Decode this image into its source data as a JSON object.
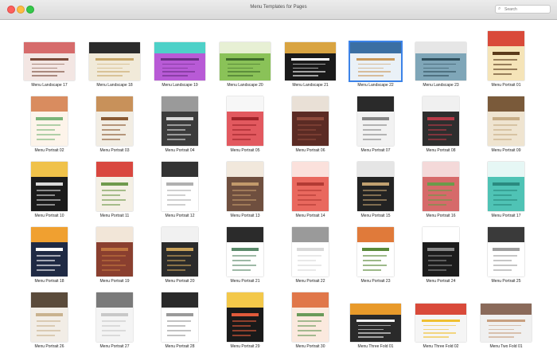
{
  "window": {
    "title": "Menu Templates for Pages"
  },
  "search": {
    "placeholder": "Search",
    "value": ""
  },
  "templates": [
    {
      "label": "Menu Landscape 17",
      "orientation": "land",
      "colors": [
        "#f3e6e3",
        "#d66b6b",
        "#7a4b3a"
      ]
    },
    {
      "label": "Menu Landscape 18",
      "orientation": "land",
      "colors": [
        "#f1ead9",
        "#2b2b2b",
        "#c9a86a"
      ]
    },
    {
      "label": "Menu Landscape 19",
      "orientation": "land",
      "colors": [
        "#b85ad6",
        "#4ed1c8",
        "#6b2d85"
      ]
    },
    {
      "label": "Menu Landscape 20",
      "orientation": "land",
      "colors": [
        "#8ac258",
        "#e7f0d4",
        "#3e6b2a"
      ]
    },
    {
      "label": "Menu Landscape 21",
      "orientation": "land",
      "colors": [
        "#1a1a1a",
        "#d9a441",
        "#ffffff"
      ]
    },
    {
      "label": "Menu Landscape 22",
      "orientation": "land",
      "colors": [
        "#eaf1f7",
        "#3b6fa3",
        "#c99a5c"
      ],
      "selected": true
    },
    {
      "label": "Menu Landscape 23",
      "orientation": "land",
      "colors": [
        "#7fa6b8",
        "#e6e6e6",
        "#2f4f5c"
      ]
    },
    {
      "label": "Menu Portrait 01",
      "orientation": "port",
      "colors": [
        "#f5e4b8",
        "#d94a3a",
        "#5a3a1a"
      ]
    },
    {
      "label": "Menu Portrait 02",
      "orientation": "port",
      "colors": [
        "#fdf4ea",
        "#d98c5f",
        "#7bb57a"
      ]
    },
    {
      "label": "Menu Portrait 03",
      "orientation": "port",
      "colors": [
        "#f2ede3",
        "#c8915a",
        "#8a5a33"
      ]
    },
    {
      "label": "Menu Portrait 04",
      "orientation": "port",
      "colors": [
        "#3c3c3c",
        "#9a9a9a",
        "#d8d8d8"
      ]
    },
    {
      "label": "Menu Portrait 05",
      "orientation": "port",
      "colors": [
        "#e2595f",
        "#f7f7f7",
        "#a0242a"
      ]
    },
    {
      "label": "Menu Portrait 06",
      "orientation": "port",
      "colors": [
        "#5b2b24",
        "#e9e0d6",
        "#8e4a3c"
      ]
    },
    {
      "label": "Menu Portrait 07",
      "orientation": "port",
      "colors": [
        "#f2f2f2",
        "#2a2a2a",
        "#888888"
      ]
    },
    {
      "label": "Menu Portrait 08",
      "orientation": "port",
      "colors": [
        "#2e2e2e",
        "#f0f0f0",
        "#b73a48"
      ]
    },
    {
      "label": "Menu Portrait 09",
      "orientation": "port",
      "colors": [
        "#efe4d0",
        "#7a5a3a",
        "#c7ad86"
      ]
    },
    {
      "label": "Menu Portrait 10",
      "orientation": "port",
      "colors": [
        "#1b1b1b",
        "#f0c24a",
        "#d9d9d9"
      ]
    },
    {
      "label": "Menu Portrait 11",
      "orientation": "port",
      "colors": [
        "#f4efe4",
        "#d9473f",
        "#6f9a4d"
      ]
    },
    {
      "label": "Menu Portrait 12",
      "orientation": "port",
      "colors": [
        "#ffffff",
        "#333333",
        "#b0b0b0"
      ]
    },
    {
      "label": "Menu Portrait 13",
      "orientation": "port",
      "colors": [
        "#6f4f3f",
        "#f1e8dc",
        "#c29a6b"
      ]
    },
    {
      "label": "Menu Portrait 14",
      "orientation": "port",
      "colors": [
        "#e9685e",
        "#fbe1dc",
        "#b23a33"
      ]
    },
    {
      "label": "Menu Portrait 15",
      "orientation": "port",
      "colors": [
        "#232323",
        "#e5e5e5",
        "#c0a070"
      ]
    },
    {
      "label": "Menu Portrait 16",
      "orientation": "port",
      "colors": [
        "#d66a6a",
        "#f4d9d9",
        "#6b9a4a"
      ]
    },
    {
      "label": "Menu Portrait 17",
      "orientation": "port",
      "colors": [
        "#4fc3b5",
        "#e6f7f5",
        "#2a8a7f"
      ]
    },
    {
      "label": "Menu Portrait 18",
      "orientation": "port",
      "colors": [
        "#1f2a44",
        "#f0a030",
        "#ffffff"
      ]
    },
    {
      "label": "Menu Portrait 19",
      "orientation": "port",
      "colors": [
        "#8a3f2f",
        "#f2e6d8",
        "#c0753f"
      ]
    },
    {
      "label": "Menu Portrait 20",
      "orientation": "port",
      "colors": [
        "#2b2b2b",
        "#f1f1f1",
        "#c9a25a"
      ]
    },
    {
      "label": "Menu Portrait 21",
      "orientation": "port",
      "colors": [
        "#ffffff",
        "#2b2b2b",
        "#5b8a6b"
      ]
    },
    {
      "label": "Menu Portrait 22",
      "orientation": "port",
      "colors": [
        "#ffffff",
        "#9a9a9a",
        "#d9d9d9"
      ]
    },
    {
      "label": "Menu Portrait 23",
      "orientation": "port",
      "colors": [
        "#ffffff",
        "#e07a3a",
        "#5a8a3a"
      ]
    },
    {
      "label": "Menu Portrait 24",
      "orientation": "port",
      "colors": [
        "#1c1c1c",
        "#ffffff",
        "#888888"
      ]
    },
    {
      "label": "Menu Portrait 25",
      "orientation": "port",
      "colors": [
        "#ffffff",
        "#3a3a3a",
        "#a0a0a0"
      ]
    },
    {
      "label": "Menu Portrait 26",
      "orientation": "port",
      "colors": [
        "#f2ede6",
        "#5b4b3b",
        "#c9b28f"
      ]
    },
    {
      "label": "Menu Portrait 27",
      "orientation": "port",
      "colors": [
        "#f4f4f4",
        "#7a7a7a",
        "#c8c8c8"
      ]
    },
    {
      "label": "Menu Portrait 28",
      "orientation": "port",
      "colors": [
        "#ffffff",
        "#2a2a2a",
        "#9a9a9a"
      ]
    },
    {
      "label": "Menu Portrait 29",
      "orientation": "port",
      "colors": [
        "#1a1a1a",
        "#f3c84a",
        "#e05a3a"
      ]
    },
    {
      "label": "Menu Portrait 30",
      "orientation": "port",
      "colors": [
        "#fbe9de",
        "#e0774a",
        "#6a9a5a"
      ]
    },
    {
      "label": "Menu Three Fold 01",
      "orientation": "land",
      "colors": [
        "#2a2a2a",
        "#e89a2a",
        "#f5f5f5"
      ]
    },
    {
      "label": "Menu Three Fold 02",
      "orientation": "land",
      "colors": [
        "#f5f5f5",
        "#d94a3a",
        "#f0c030"
      ]
    },
    {
      "label": "Menu Two Fold 01",
      "orientation": "land",
      "colors": [
        "#f0f0f0",
        "#8a6a5a",
        "#c8a080"
      ]
    }
  ]
}
